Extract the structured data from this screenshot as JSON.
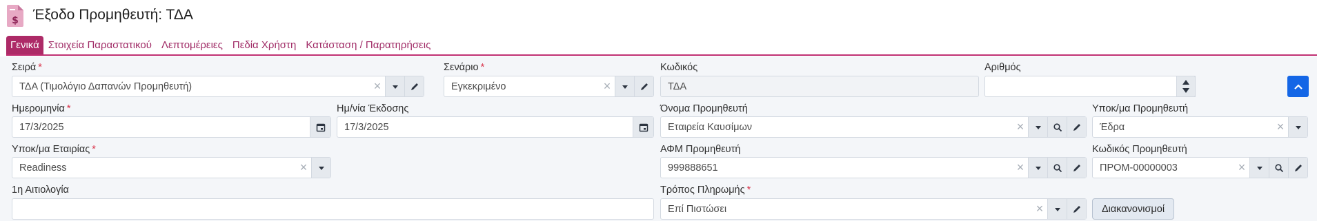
{
  "header": {
    "title": "Έξοδο Προμηθευτή: ΤΔΑ",
    "icon": "invoice-dollar-icon"
  },
  "tabs": [
    {
      "label": "Γενικά",
      "active": true
    },
    {
      "label": "Στοιχεία Παραστατικού"
    },
    {
      "label": "Λεπτομέρειες"
    },
    {
      "label": "Πεδία Χρήστη"
    },
    {
      "label": "Κατάσταση / Παρατηρήσεις"
    }
  ],
  "fields": {
    "series": {
      "label": "Σειρά",
      "required_mark": "*",
      "value": "ΤΔΑ (Τιμολόγιο Δαπανών Προμηθευτή)"
    },
    "scenario": {
      "label": "Σενάριο",
      "required_mark": "*",
      "value": "Εγκεκριμένο"
    },
    "code": {
      "label": "Κωδικός",
      "value": "ΤΔΑ"
    },
    "number": {
      "label": "Αριθμός",
      "value": ""
    },
    "date": {
      "label": "Ημερομηνία",
      "required_mark": "*",
      "value": "17/3/2025"
    },
    "issue_date": {
      "label": "Ημ/νία Έκδοσης",
      "value": "17/3/2025"
    },
    "supplier_name": {
      "label": "Όνομα Προμηθευτή",
      "value": "Εταιρεία Καυσίμων"
    },
    "supplier_branch": {
      "label": "Υποκ/μα Προμηθευτή",
      "value": "Έδρα"
    },
    "company_branch": {
      "label": "Υποκ/μα Εταιρίας",
      "required_mark": "*",
      "value": "Readiness"
    },
    "supplier_vat": {
      "label": "ΑΦΜ Προμηθευτή",
      "value": "999888651"
    },
    "supplier_code": {
      "label": "Κωδικός Προμηθευτή",
      "value": "ΠΡΟΜ-00000003"
    },
    "reason": {
      "label": "1η Αιτιολογία",
      "value": ""
    },
    "payment_method": {
      "label": "Τρόπος Πληρωμής",
      "required_mark": "*",
      "value": "Επί Πιστώσει"
    }
  },
  "buttons": {
    "settlements_label": "Διακανονισμοί"
  },
  "colors": {
    "accent": "#ad2a67",
    "primary": "#1466e6"
  }
}
